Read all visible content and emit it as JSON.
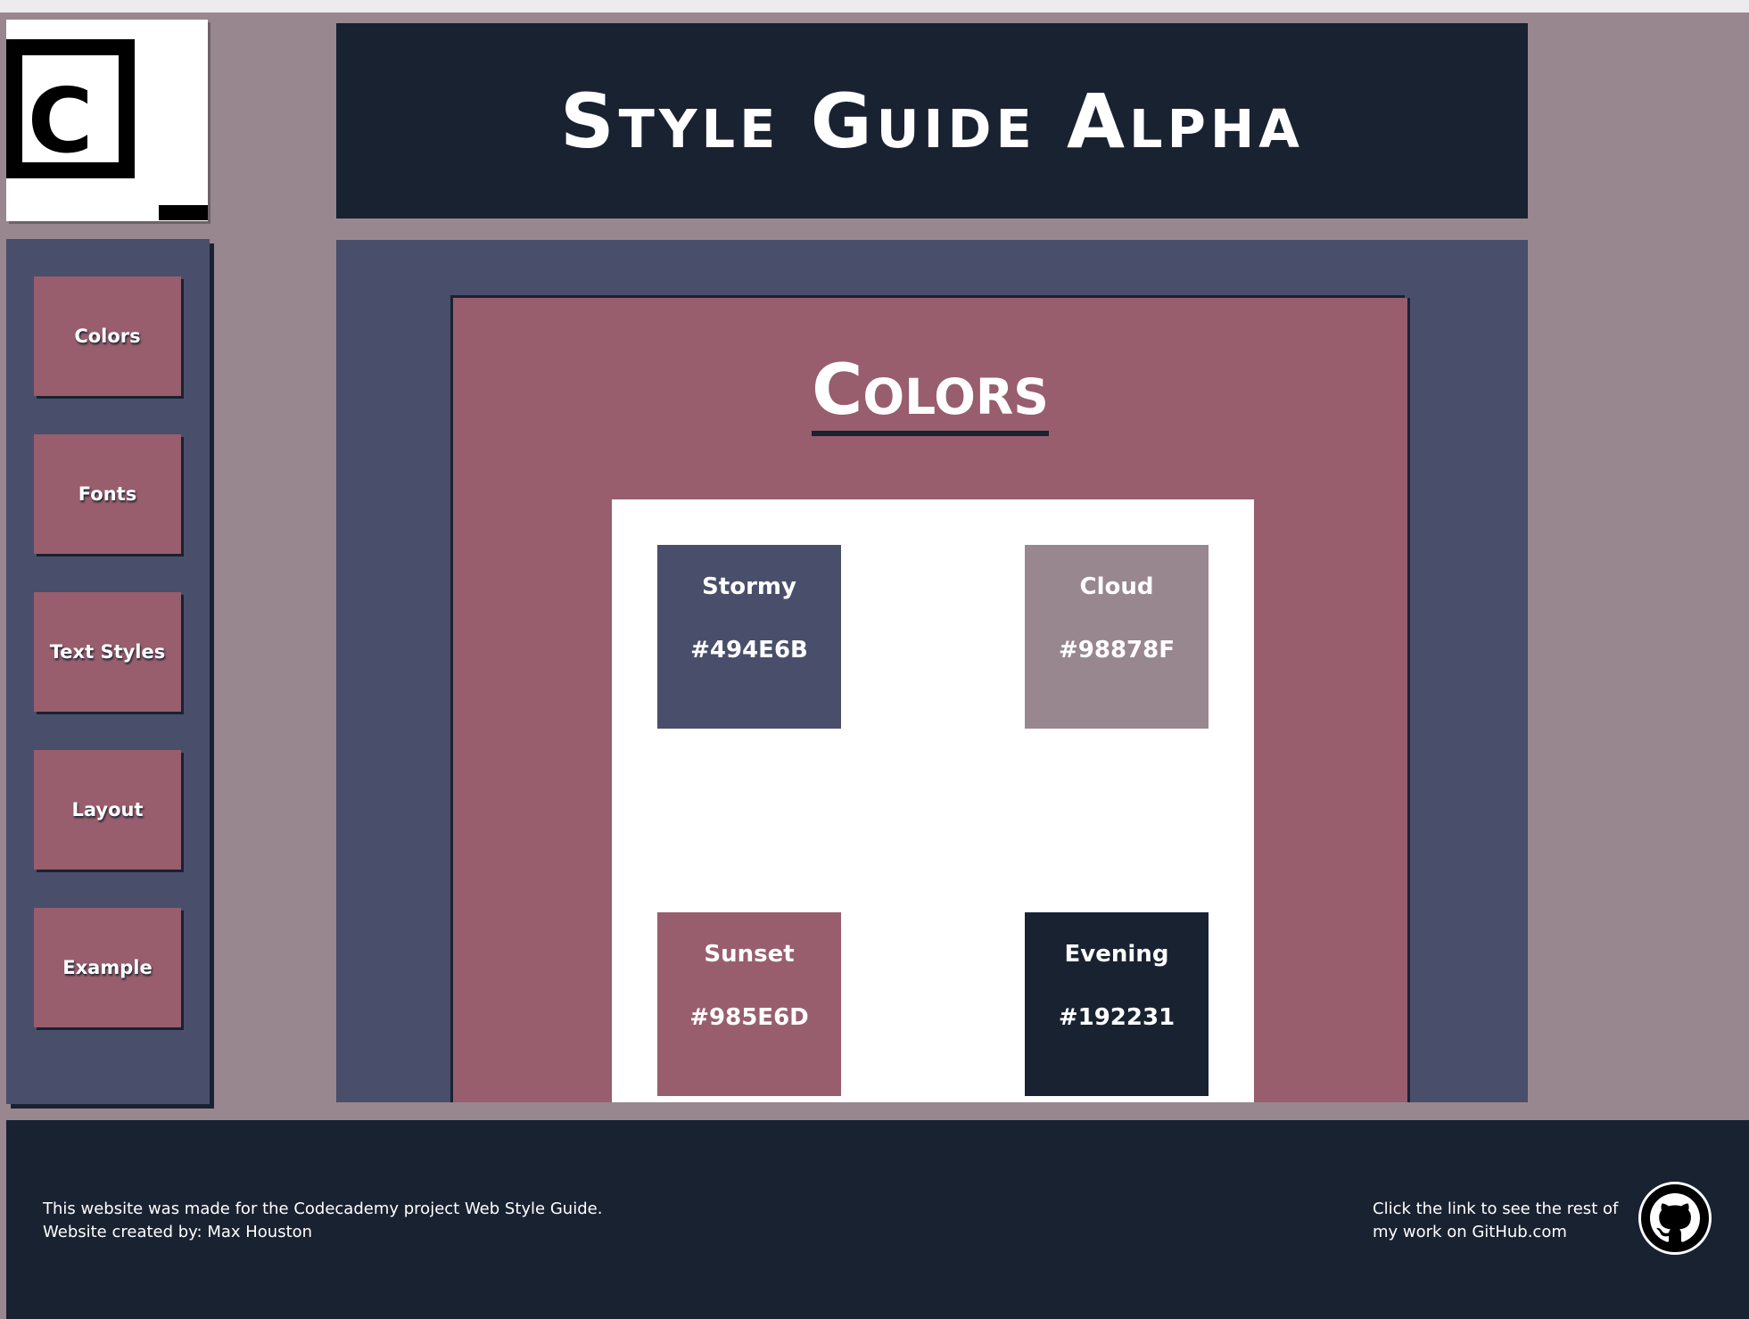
{
  "logo": {
    "letter": "C"
  },
  "header": {
    "title": "Style Guide Alpha"
  },
  "sidebar": {
    "items": [
      {
        "label": "Colors"
      },
      {
        "label": "Fonts"
      },
      {
        "label": "Text Styles"
      },
      {
        "label": "Layout"
      },
      {
        "label": "Example"
      }
    ]
  },
  "main": {
    "heading": "Colors",
    "swatches": [
      {
        "name": "Stormy",
        "hex": "#494E6B",
        "color": "#494E6B"
      },
      {
        "name": "Cloud",
        "hex": "#98878F",
        "color": "#98878F"
      },
      {
        "name": "Sunset",
        "hex": "#985E6D",
        "color": "#985E6D"
      },
      {
        "name": "Evening",
        "hex": "#192231",
        "color": "#192231"
      }
    ]
  },
  "footer": {
    "line1": "This website was made for the Codecademy project Web Style Guide.",
    "line2": "Website created by: Max Houston",
    "right_text": "Click the link to see the rest of my work on GitHub.com",
    "github_icon": "github-icon"
  },
  "colors": {
    "stormy": "#494E6B",
    "cloud": "#98878F",
    "sunset": "#985E6D",
    "evening": "#192231"
  }
}
